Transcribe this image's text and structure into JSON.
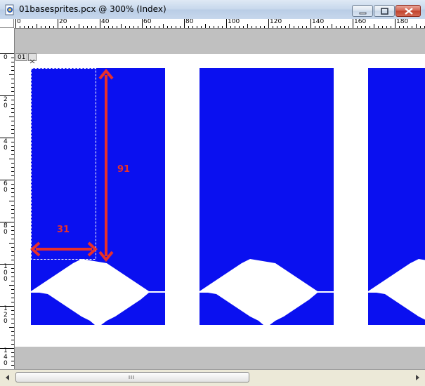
{
  "window": {
    "title": "01basesprites.pcx @ 300% (Index)"
  },
  "icons": {
    "app": "psp-document-icon",
    "minimize": "minimize-icon",
    "maximize": "maximize-icon",
    "close": "close-icon",
    "layer": "layer-icon",
    "scroll_left": "scroll-left-arrow-icon",
    "scroll_right": "scroll-right-arrow-icon"
  },
  "rulers": {
    "horizontal": [
      "0",
      "20",
      "40",
      "60",
      "80",
      "100",
      "120",
      "140",
      "160",
      "180"
    ],
    "vertical": [
      "0",
      "20",
      "40",
      "60",
      "80",
      "100",
      "120",
      "140"
    ]
  },
  "layer_tab": {
    "label": "01"
  },
  "annotations": {
    "width_label": "31",
    "height_label": "91"
  },
  "colors": {
    "sprite_blue": "#0a10f0",
    "annotation_red": "#e8302a",
    "canvas_gray": "#c0c0c0"
  }
}
